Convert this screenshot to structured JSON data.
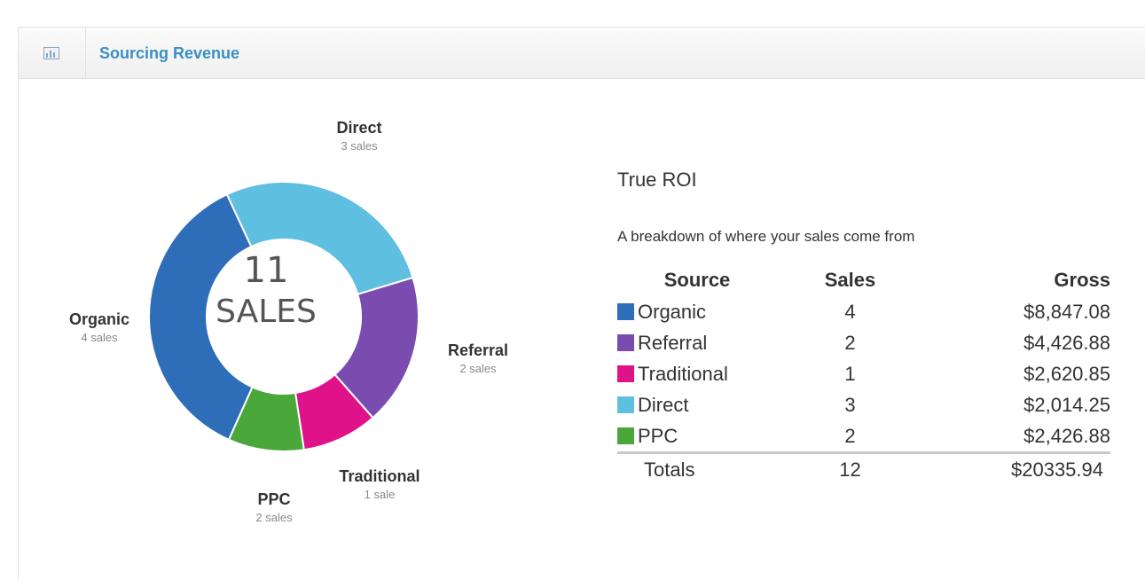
{
  "panel": {
    "title": "Sourcing Revenue",
    "icon": "chart-icon"
  },
  "donut": {
    "center_count": "11",
    "center_label": "SALES",
    "labels": [
      {
        "name": "Direct",
        "sub": "3 sales"
      },
      {
        "name": "Organic",
        "sub": "4 sales"
      },
      {
        "name": "Referral",
        "sub": "2 sales"
      },
      {
        "name": "Traditional",
        "sub": "1 sale"
      },
      {
        "name": "PPC",
        "sub": "2 sales"
      }
    ]
  },
  "roi": {
    "title": "True ROI",
    "subtitle": "A breakdown of where your sales come from",
    "headers": {
      "source": "Source",
      "sales": "Sales",
      "gross": "Gross"
    },
    "rows": [
      {
        "source": "Organic",
        "sales": "4",
        "gross": "$8,847.08",
        "color": "#2e6db8"
      },
      {
        "source": "Referral",
        "sales": "2",
        "gross": "$4,426.88",
        "color": "#7a4cb0"
      },
      {
        "source": "Traditional",
        "sales": "1",
        "gross": "$2,620.85",
        "color": "#e0128a"
      },
      {
        "source": "Direct",
        "sales": "3",
        "gross": "$2,014.25",
        "color": "#5fbfe0"
      },
      {
        "source": "PPC",
        "sales": "2",
        "gross": "$2,426.88",
        "color": "#4aa83a"
      }
    ],
    "totals": {
      "label": "Totals",
      "sales": "12",
      "gross": "$20335.94"
    }
  },
  "chart_data": {
    "type": "pie",
    "title": "",
    "categories": [
      "Direct",
      "Referral",
      "Traditional",
      "PPC",
      "Organic"
    ],
    "values": [
      3,
      2,
      1,
      1,
      4
    ],
    "colors": [
      "#5fbfe0",
      "#7a4cb0",
      "#e0128a",
      "#4aa83a",
      "#2e6db8"
    ],
    "donut": true,
    "start_angle_deg": -25,
    "center_text": "11 SALES",
    "legend": "none"
  }
}
